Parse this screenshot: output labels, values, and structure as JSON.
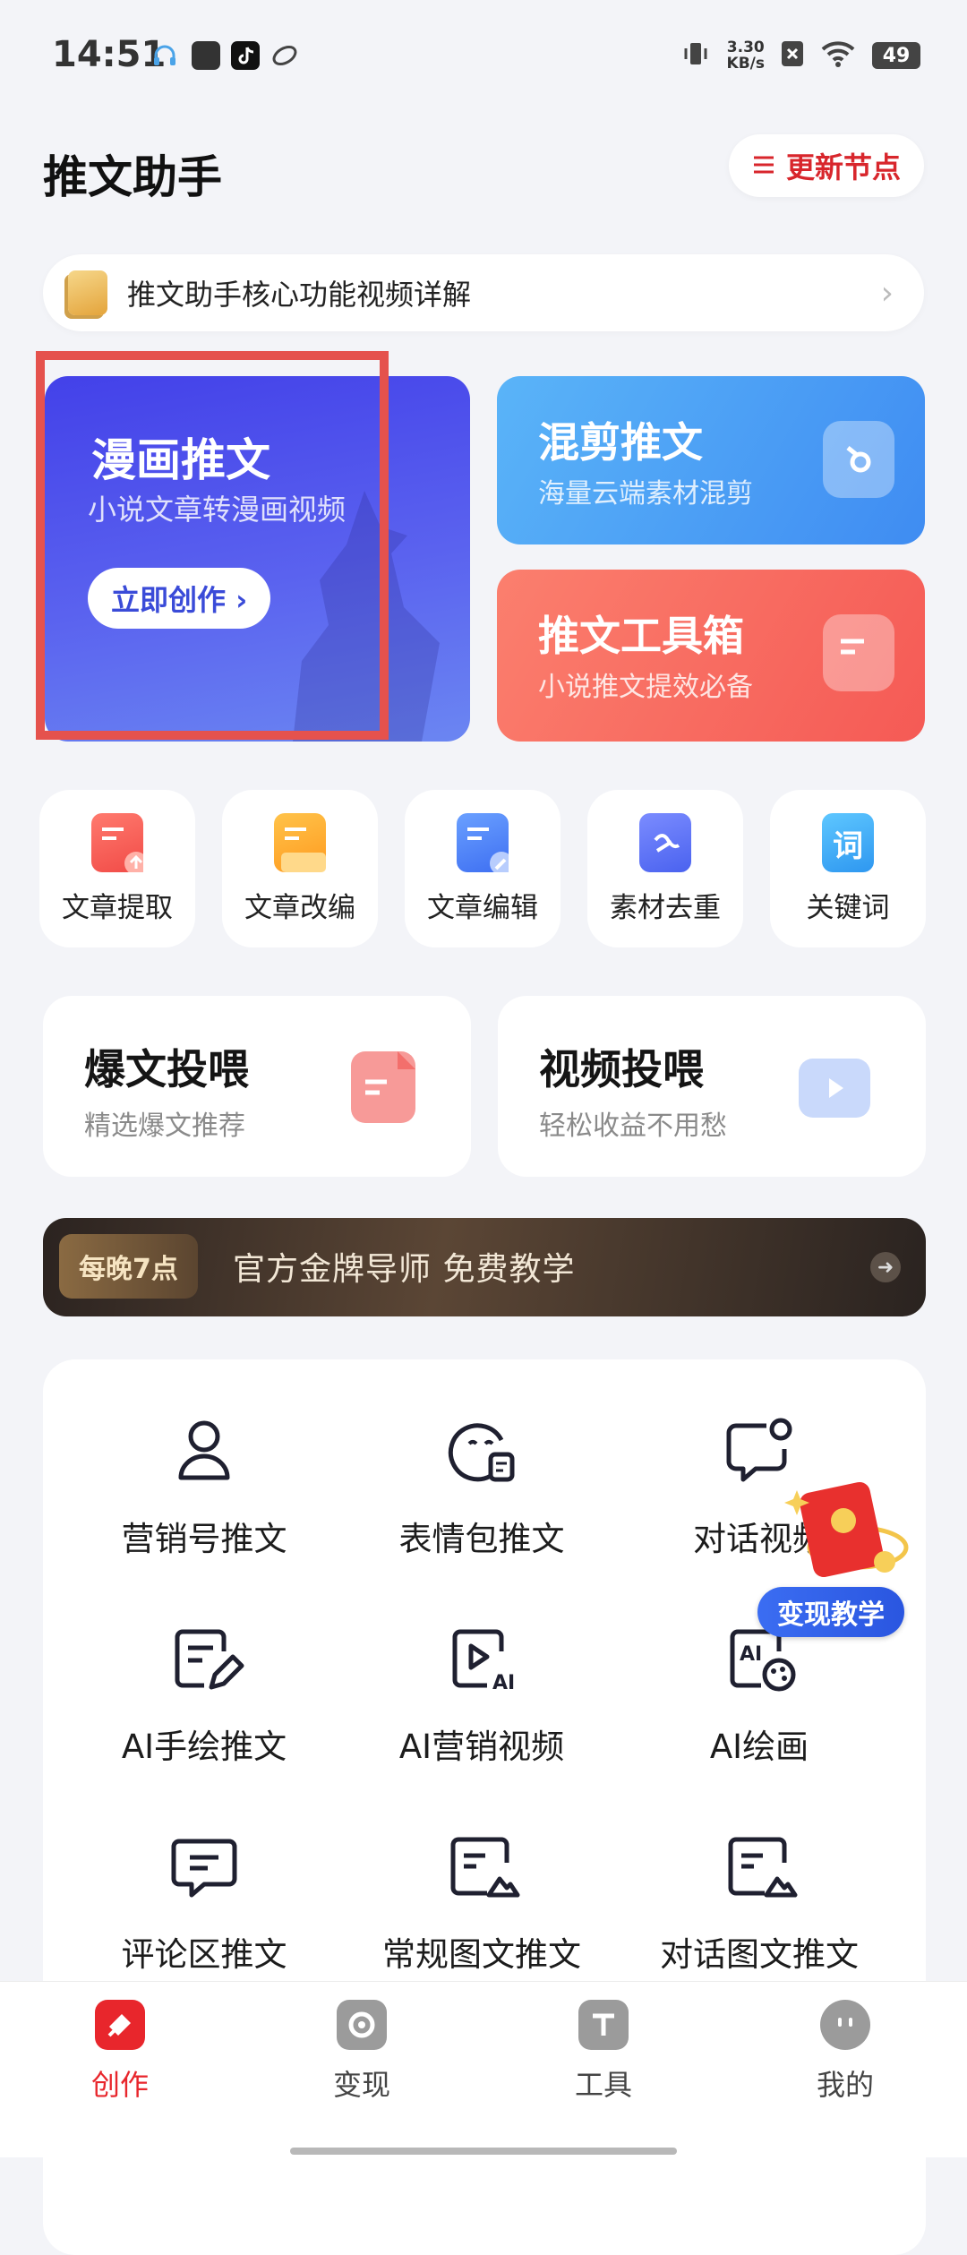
{
  "status": {
    "time": "14:51",
    "net_speed_value": "3.30",
    "net_speed_unit": "KB/s",
    "battery": "49"
  },
  "header": {
    "title": "推文助手",
    "update_label": "更新节点"
  },
  "intro_banner": {
    "text": "推文助手核心功能视频详解"
  },
  "cards": {
    "manhua": {
      "title": "漫画推文",
      "subtitle": "小说文章转漫画视频",
      "button": "立即创作 ›"
    },
    "mix": {
      "title": "混剪推文",
      "subtitle": "海量云端素材混剪"
    },
    "toolbox": {
      "title": "推文工具箱",
      "subtitle": "小说推文提效必备"
    }
  },
  "tools": [
    {
      "label": "文章提取"
    },
    {
      "label": "文章改编"
    },
    {
      "label": "文章编辑"
    },
    {
      "label": "素材去重"
    },
    {
      "label": "关键词",
      "icon_text": "词"
    }
  ],
  "promos": [
    {
      "title": "爆文投喂",
      "subtitle": "精选爆文推荐"
    },
    {
      "title": "视频投喂",
      "subtitle": "轻松收益不用愁"
    }
  ],
  "tutor_banner": {
    "badge": "每晚7点",
    "text": "官方金牌导师  免费教学"
  },
  "grid": [
    {
      "label": "营销号推文",
      "icon": "person-icon"
    },
    {
      "label": "表情包推文",
      "icon": "emoji-icon"
    },
    {
      "label": "对话视频",
      "icon": "chat-bubble-icon"
    },
    {
      "label": "AI手绘推文",
      "icon": "edit-icon"
    },
    {
      "label": "AI营销视频",
      "icon": "ai-video-icon"
    },
    {
      "label": "AI绘画",
      "icon": "ai-palette-icon"
    },
    {
      "label": "评论区推文",
      "icon": "comment-icon"
    },
    {
      "label": "常规图文推文",
      "icon": "image-doc-icon"
    },
    {
      "label": "对话图文推文",
      "icon": "image-doc-icon"
    }
  ],
  "floating": {
    "badge": "变现教学"
  },
  "nav": [
    {
      "label": "创作",
      "active": true
    },
    {
      "label": "变现"
    },
    {
      "label": "工具"
    },
    {
      "label": "我的"
    }
  ],
  "colors": {
    "accent_red": "#e8262c",
    "manhua_blue": "#4341e9",
    "mix_blue": "#3f8cf2",
    "toolbox_red": "#f55a55",
    "highlight": "#e5524d"
  }
}
